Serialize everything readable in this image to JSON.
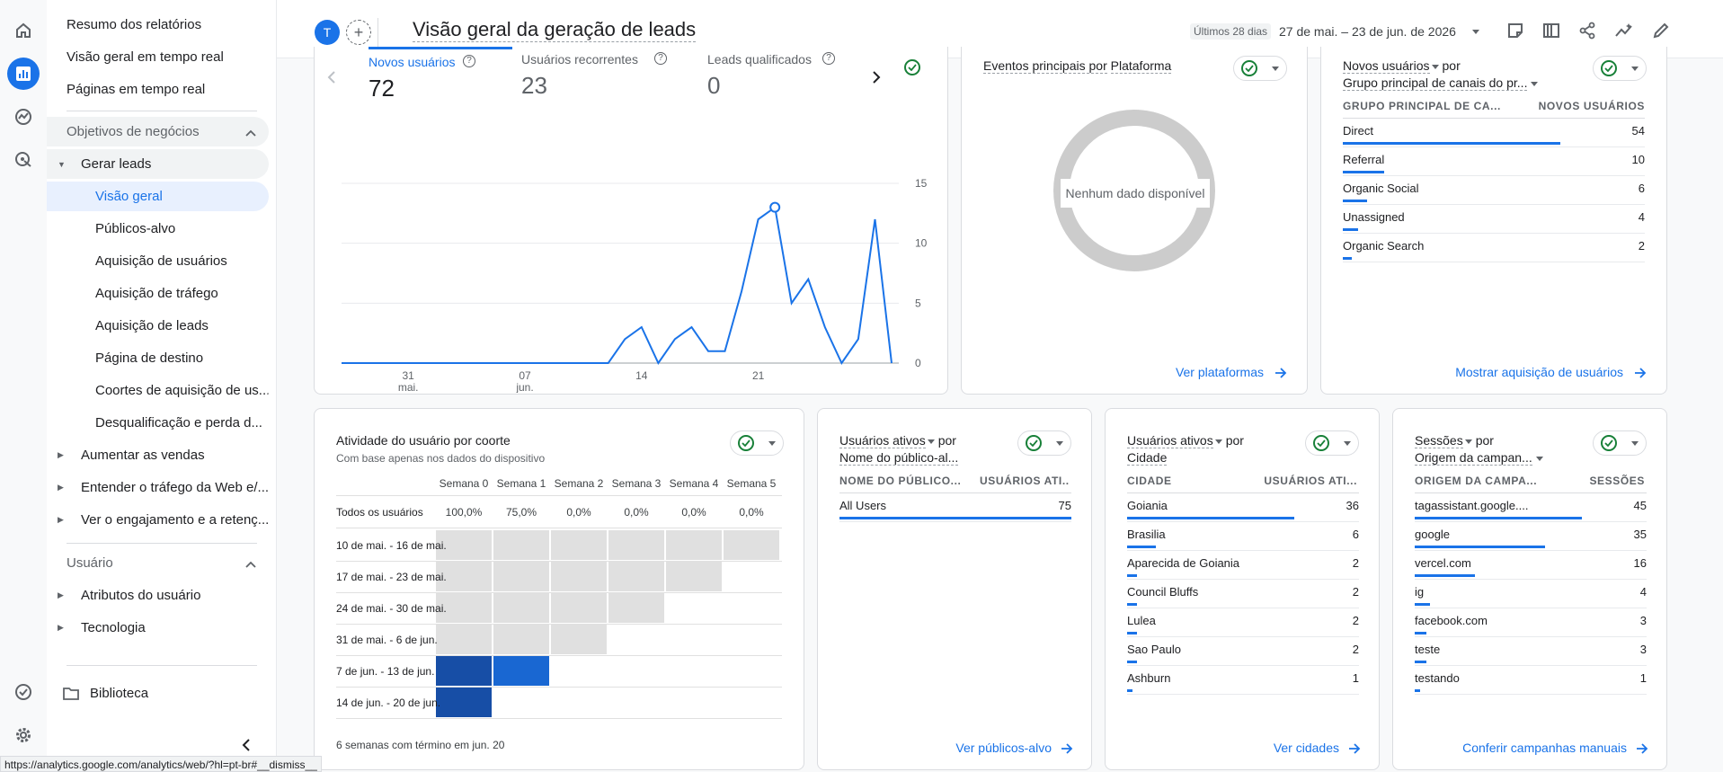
{
  "nav": {
    "items": [
      {
        "label": "Resumo dos relatórios"
      },
      {
        "label": "Visão geral em tempo real"
      },
      {
        "label": "Páginas em tempo real"
      }
    ],
    "section_business": "Objetivos de negócios",
    "generate_leads": "Gerar leads",
    "sub_items": [
      {
        "label": "Visão geral"
      },
      {
        "label": "Públicos-alvo"
      },
      {
        "label": "Aquisição de usuários"
      },
      {
        "label": "Aquisição de tráfego"
      },
      {
        "label": "Aquisição de leads"
      },
      {
        "label": "Página de destino"
      },
      {
        "label": "Coortes de aquisição de us..."
      },
      {
        "label": "Desqualificação e perda d..."
      }
    ],
    "groups": [
      {
        "label": "Aumentar as vendas"
      },
      {
        "label": "Entender o tráfego da Web e/..."
      },
      {
        "label": "Ver o engajamento e a retenç..."
      }
    ],
    "section_user": "Usuário",
    "user_items": [
      {
        "label": "Atributos do usuário"
      },
      {
        "label": "Tecnologia"
      }
    ],
    "library": "Biblioteca"
  },
  "topbar": {
    "avatar_letter": "T",
    "title": "Visão geral da geração de leads",
    "date_prefix": "Últimos 28 dias",
    "date_range": "27 de mai. – 23 de jun. de 2026"
  },
  "metrics": [
    {
      "label": "Novos usuários",
      "value": "72"
    },
    {
      "label": "Usuários recorrentes",
      "value": "23"
    },
    {
      "label": "Leads qualificados",
      "value": "0"
    }
  ],
  "chart_data": {
    "type": "line",
    "series": [
      {
        "values": [
          0,
          0,
          0,
          0,
          0,
          0,
          0,
          0,
          0,
          0,
          0,
          0,
          0,
          0,
          0,
          0,
          0,
          2,
          3,
          0,
          2,
          3,
          1,
          1,
          6,
          12,
          13,
          5,
          7,
          3,
          0,
          2,
          12,
          0
        ]
      }
    ],
    "x_tick_labels": [
      {
        "day": "31",
        "month": "mai."
      },
      {
        "day": "07",
        "month": "jun."
      },
      {
        "day": "14",
        "month": ""
      },
      {
        "day": "21",
        "month": ""
      }
    ],
    "x_tick_index": [
      4,
      11,
      18,
      25
    ],
    "y_ticks": [
      "15",
      "10",
      "5",
      "0"
    ],
    "ylim": [
      0,
      15
    ],
    "highlight_index": 26
  },
  "platform_card": {
    "title_prefix": "Eventos principais por",
    "title_dim": "Plataforma",
    "no_data": "Nenhum dado disponível",
    "link": "Ver plataformas"
  },
  "new_users_card": {
    "title_metric": "Novos usuários",
    "title_by": "por",
    "title_dim": "Grupo principal de canais do pr...",
    "col1": "GRUPO PRINCIPAL DE CA...",
    "col2": "NOVOS USUÁRIOS",
    "rows": [
      {
        "label": "Direct",
        "value": "54",
        "pct": 1.0
      },
      {
        "label": "Referral",
        "value": "10",
        "pct": 0.19
      },
      {
        "label": "Organic Social",
        "value": "6",
        "pct": 0.11
      },
      {
        "label": "Unassigned",
        "value": "4",
        "pct": 0.07
      },
      {
        "label": "Organic Search",
        "value": "2",
        "pct": 0.04
      }
    ],
    "link": "Mostrar aquisição de usuários"
  },
  "cohort_card": {
    "title": "Atividade do usuário por coorte",
    "subtitle": "Com base apenas nos dados do dispositivo",
    "weeks": [
      "Semana 0",
      "Semana 1",
      "Semana 2",
      "Semana 3",
      "Semana 4",
      "Semana 5"
    ],
    "all_label": "Todos os usuários",
    "all_values": [
      "100,0%",
      "75,0%",
      "0,0%",
      "0,0%",
      "0,0%",
      "0,0%"
    ],
    "rows": [
      {
        "label": "10 de mai. - 16 de mai.",
        "cells": 6
      },
      {
        "label": "17 de mai. - 23 de mai.",
        "cells": 5
      },
      {
        "label": "24 de mai. - 30 de mai.",
        "cells": 4
      },
      {
        "label": "31 de mai. - 6 de jun.",
        "cells": 3
      },
      {
        "label": "7 de jun. - 13 de jun.",
        "cells": 2
      },
      {
        "label": "14 de jun. - 20 de jun.",
        "cells": 1
      }
    ],
    "footer": "6 semanas com término em jun. 20"
  },
  "audience_card": {
    "title_metric": "Usuários ativos",
    "title_by": "por",
    "title_dim": "Nome do público-al...",
    "col1": "NOME DO PÚBLICO...",
    "col2": "USUÁRIOS ATI...",
    "rows": [
      {
        "label": "All Users",
        "value": "75",
        "pct": 1.0
      }
    ],
    "link": "Ver públicos-alvo"
  },
  "city_card": {
    "title_metric": "Usuários ativos",
    "title_by": "por",
    "title_dim": "Cidade",
    "col1": "CIDADE",
    "col2": "USUÁRIOS ATI...",
    "rows": [
      {
        "label": "Goiania",
        "value": "36",
        "pct": 1.0
      },
      {
        "label": "Brasilia",
        "value": "6",
        "pct": 0.17
      },
      {
        "label": "Aparecida de Goiania",
        "value": "2",
        "pct": 0.06
      },
      {
        "label": "Council Bluffs",
        "value": "2",
        "pct": 0.06
      },
      {
        "label": "Lulea",
        "value": "2",
        "pct": 0.06
      },
      {
        "label": "Sao Paulo",
        "value": "2",
        "pct": 0.06
      },
      {
        "label": "Ashburn",
        "value": "1",
        "pct": 0.03
      }
    ],
    "link": "Ver cidades"
  },
  "sessions_card": {
    "title_metric": "Sessões",
    "title_by": "por",
    "title_dim": "Origem da campan...",
    "col1": "ORIGEM DA CAMPA...",
    "col2": "SESSÕES",
    "rows": [
      {
        "label": "tagassistant.google....",
        "value": "45",
        "pct": 1.0
      },
      {
        "label": "google",
        "value": "35",
        "pct": 0.78
      },
      {
        "label": "vercel.com",
        "value": "16",
        "pct": 0.36
      },
      {
        "label": "ig",
        "value": "4",
        "pct": 0.09
      },
      {
        "label": "facebook.com",
        "value": "3",
        "pct": 0.07
      },
      {
        "label": "teste",
        "value": "3",
        "pct": 0.07
      },
      {
        "label": "testando",
        "value": "1",
        "pct": 0.02
      }
    ],
    "link": "Conferir campanhas manuais"
  },
  "status_url": "https://analytics.google.com/analytics/web/?hl=pt-br#__dismiss__",
  "colors": {
    "accent": "#1a73e8",
    "check": "#188038",
    "cohort_dark": "#174ea6",
    "cohort_mid": "#1967d2",
    "cohort_empty": "#e0e0e0"
  }
}
